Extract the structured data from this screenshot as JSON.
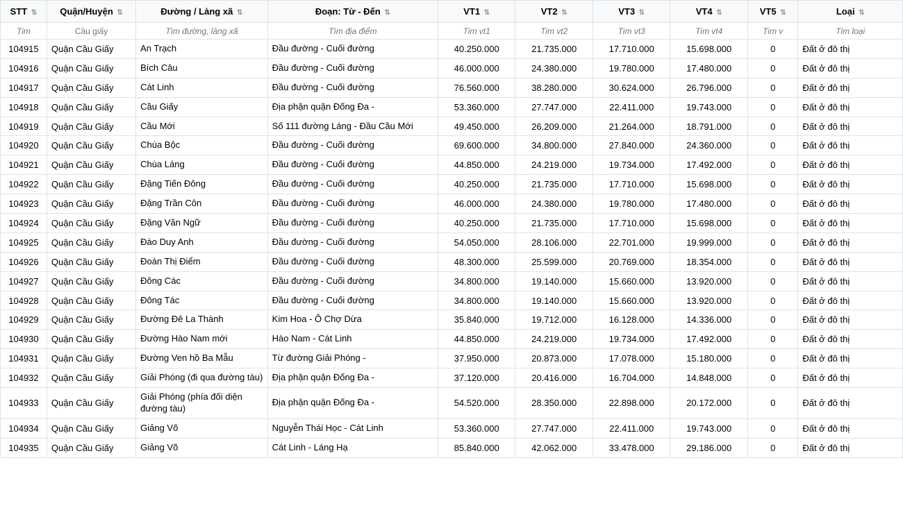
{
  "table": {
    "headers": [
      {
        "label": "STT",
        "key": "stt"
      },
      {
        "label": "Quận/Huyện",
        "key": "quan"
      },
      {
        "label": "Đường / Làng xã",
        "key": "duong"
      },
      {
        "label": "Đoạn: Từ - Đến",
        "key": "doan"
      },
      {
        "label": "VT1",
        "key": "vt1"
      },
      {
        "label": "VT2",
        "key": "vt2"
      },
      {
        "label": "VT3",
        "key": "vt3"
      },
      {
        "label": "VT4",
        "key": "vt4"
      },
      {
        "label": "VT5",
        "key": "vt5"
      },
      {
        "label": "Loại",
        "key": "loai"
      }
    ],
    "search_placeholders": {
      "stt": "Tim",
      "quan": "Cầu giấy",
      "duong": "Tìm đường, làng xã",
      "doan": "Tìm địa điểm",
      "vt1": "Tim vt1",
      "vt2": "Tim vt2",
      "vt3": "Tim vt3",
      "vt4": "Tim vt4",
      "vt5": "Tim v",
      "loai": "Tim loại"
    },
    "rows": [
      {
        "stt": "104915",
        "quan": "Quận Cầu Giấy",
        "duong": "An Trạch",
        "doan": "Đầu đường - Cuối đường",
        "vt1": "40.250.000",
        "vt2": "21.735.000",
        "vt3": "17.710.000",
        "vt4": "15.698.000",
        "vt5": "0",
        "loai": "Đất ở đô thị"
      },
      {
        "stt": "104916",
        "quan": "Quận Cầu Giấy",
        "duong": "Bích Câu",
        "doan": "Đầu đường - Cuối đường",
        "vt1": "46.000.000",
        "vt2": "24.380.000",
        "vt3": "19.780.000",
        "vt4": "17.480.000",
        "vt5": "0",
        "loai": "Đất ở đô thị"
      },
      {
        "stt": "104917",
        "quan": "Quận Cầu Giấy",
        "duong": "Cát Linh",
        "doan": "Đầu đường - Cuối đường",
        "vt1": "76.560.000",
        "vt2": "38.280.000",
        "vt3": "30.624.000",
        "vt4": "26.796.000",
        "vt5": "0",
        "loai": "Đất ở đô thị"
      },
      {
        "stt": "104918",
        "quan": "Quận Cầu Giấy",
        "duong": "Cầu Giấy",
        "doan": "Địa phận quận Đống Đa -",
        "vt1": "53.360.000",
        "vt2": "27.747.000",
        "vt3": "22.411.000",
        "vt4": "19.743.000",
        "vt5": "0",
        "loai": "Đất ở đô thị"
      },
      {
        "stt": "104919",
        "quan": "Quận Cầu Giấy",
        "duong": "Cầu Mới",
        "doan": "Số 111 đường Láng - Đầu Cầu Mới",
        "vt1": "49.450.000",
        "vt2": "26.209.000",
        "vt3": "21.264.000",
        "vt4": "18.791.000",
        "vt5": "0",
        "loai": "Đất ở đô thị"
      },
      {
        "stt": "104920",
        "quan": "Quận Cầu Giấy",
        "duong": "Chùa Bộc",
        "doan": "Đầu đường - Cuối đường",
        "vt1": "69.600.000",
        "vt2": "34.800.000",
        "vt3": "27.840.000",
        "vt4": "24.360.000",
        "vt5": "0",
        "loai": "Đất ở đô thị"
      },
      {
        "stt": "104921",
        "quan": "Quận Cầu Giấy",
        "duong": "Chùa Láng",
        "doan": "Đầu đường - Cuối đường",
        "vt1": "44.850.000",
        "vt2": "24.219.000",
        "vt3": "19.734.000",
        "vt4": "17.492.000",
        "vt5": "0",
        "loai": "Đất ở đô thị"
      },
      {
        "stt": "104922",
        "quan": "Quận Cầu Giấy",
        "duong": "Đặng Tiến Đông",
        "doan": "Đầu đường - Cuối đường",
        "vt1": "40.250.000",
        "vt2": "21.735.000",
        "vt3": "17.710.000",
        "vt4": "15.698.000",
        "vt5": "0",
        "loai": "Đất ở đô thị"
      },
      {
        "stt": "104923",
        "quan": "Quận Cầu Giấy",
        "duong": "Đặng Trần Côn",
        "doan": "Đầu đường - Cuối đường",
        "vt1": "46.000.000",
        "vt2": "24.380.000",
        "vt3": "19.780.000",
        "vt4": "17.480.000",
        "vt5": "0",
        "loai": "Đất ở đô thị"
      },
      {
        "stt": "104924",
        "quan": "Quận Cầu Giấy",
        "duong": "Đặng Văn Ngữ",
        "doan": "Đầu đường - Cuối đường",
        "vt1": "40.250.000",
        "vt2": "21.735.000",
        "vt3": "17.710.000",
        "vt4": "15.698.000",
        "vt5": "0",
        "loai": "Đất ở đô thị"
      },
      {
        "stt": "104925",
        "quan": "Quận Cầu Giấy",
        "duong": "Đào Duy Anh",
        "doan": "Đầu đường - Cuối đường",
        "vt1": "54.050.000",
        "vt2": "28.106.000",
        "vt3": "22.701.000",
        "vt4": "19.999.000",
        "vt5": "0",
        "loai": "Đất ở đô thị"
      },
      {
        "stt": "104926",
        "quan": "Quận Cầu Giấy",
        "duong": "Đoàn Thị Điểm",
        "doan": "Đầu đường - Cuối đường",
        "vt1": "48.300.000",
        "vt2": "25.599.000",
        "vt3": "20.769.000",
        "vt4": "18.354.000",
        "vt5": "0",
        "loai": "Đất ở đô thị"
      },
      {
        "stt": "104927",
        "quan": "Quận Cầu Giấy",
        "duong": "Đông Các",
        "doan": "Đầu đường - Cuối đường",
        "vt1": "34.800.000",
        "vt2": "19.140.000",
        "vt3": "15.660.000",
        "vt4": "13.920.000",
        "vt5": "0",
        "loai": "Đất ở đô thị"
      },
      {
        "stt": "104928",
        "quan": "Quận Cầu Giấy",
        "duong": "Đông Tác",
        "doan": "Đầu đường - Cuối đường",
        "vt1": "34.800.000",
        "vt2": "19.140.000",
        "vt3": "15.660.000",
        "vt4": "13.920.000",
        "vt5": "0",
        "loai": "Đất ở đô thị"
      },
      {
        "stt": "104929",
        "quan": "Quận Cầu Giấy",
        "duong": "Đường Đê La Thành",
        "doan": "Kim Hoa - Ô Chợ Dừa",
        "vt1": "35.840.000",
        "vt2": "19.712.000",
        "vt3": "16.128.000",
        "vt4": "14.336.000",
        "vt5": "0",
        "loai": "Đất ở đô thị"
      },
      {
        "stt": "104930",
        "quan": "Quận Cầu Giấy",
        "duong": "Đường Hào Nam mới",
        "doan": "Hào Nam - Cát Linh",
        "vt1": "44.850.000",
        "vt2": "24.219.000",
        "vt3": "19.734.000",
        "vt4": "17.492.000",
        "vt5": "0",
        "loai": "Đất ở đô thị"
      },
      {
        "stt": "104931",
        "quan": "Quận Cầu Giấy",
        "duong": "Đường Ven hồ Ba Mẫu",
        "doan": "Từ đường Giải Phóng -",
        "vt1": "37.950.000",
        "vt2": "20.873.000",
        "vt3": "17.078.000",
        "vt4": "15.180.000",
        "vt5": "0",
        "loai": "Đất ở đô thị"
      },
      {
        "stt": "104932",
        "quan": "Quận Cầu Giấy",
        "duong": "Giải Phóng (đi qua đường tàu)",
        "doan": "Địa phận quận Đống Đa -",
        "vt1": "37.120.000",
        "vt2": "20.416.000",
        "vt3": "16.704.000",
        "vt4": "14.848.000",
        "vt5": "0",
        "loai": "Đất ở đô thị"
      },
      {
        "stt": "104933",
        "quan": "Quận Cầu Giấy",
        "duong": "Giải Phóng (phía đối diện đường tàu)",
        "doan": "Địa phận quận Đống Đa -",
        "vt1": "54.520.000",
        "vt2": "28.350.000",
        "vt3": "22.898.000",
        "vt4": "20.172.000",
        "vt5": "0",
        "loai": "Đất ở đô thị"
      },
      {
        "stt": "104934",
        "quan": "Quận Cầu Giấy",
        "duong": "Giảng Võ",
        "doan": "Nguyễn Thái Học - Cát Linh",
        "vt1": "53.360.000",
        "vt2": "27.747.000",
        "vt3": "22.411.000",
        "vt4": "19.743.000",
        "vt5": "0",
        "loai": "Đất ở đô thị"
      },
      {
        "stt": "104935",
        "quan": "Quận Cầu Giấy",
        "duong": "Giảng Võ",
        "doan": "Cát Linh - Láng Hạ",
        "vt1": "85.840.000",
        "vt2": "42.062.000",
        "vt3": "33.478.000",
        "vt4": "29.186.000",
        "vt5": "0",
        "loai": "Đất ở đô thị"
      }
    ]
  }
}
